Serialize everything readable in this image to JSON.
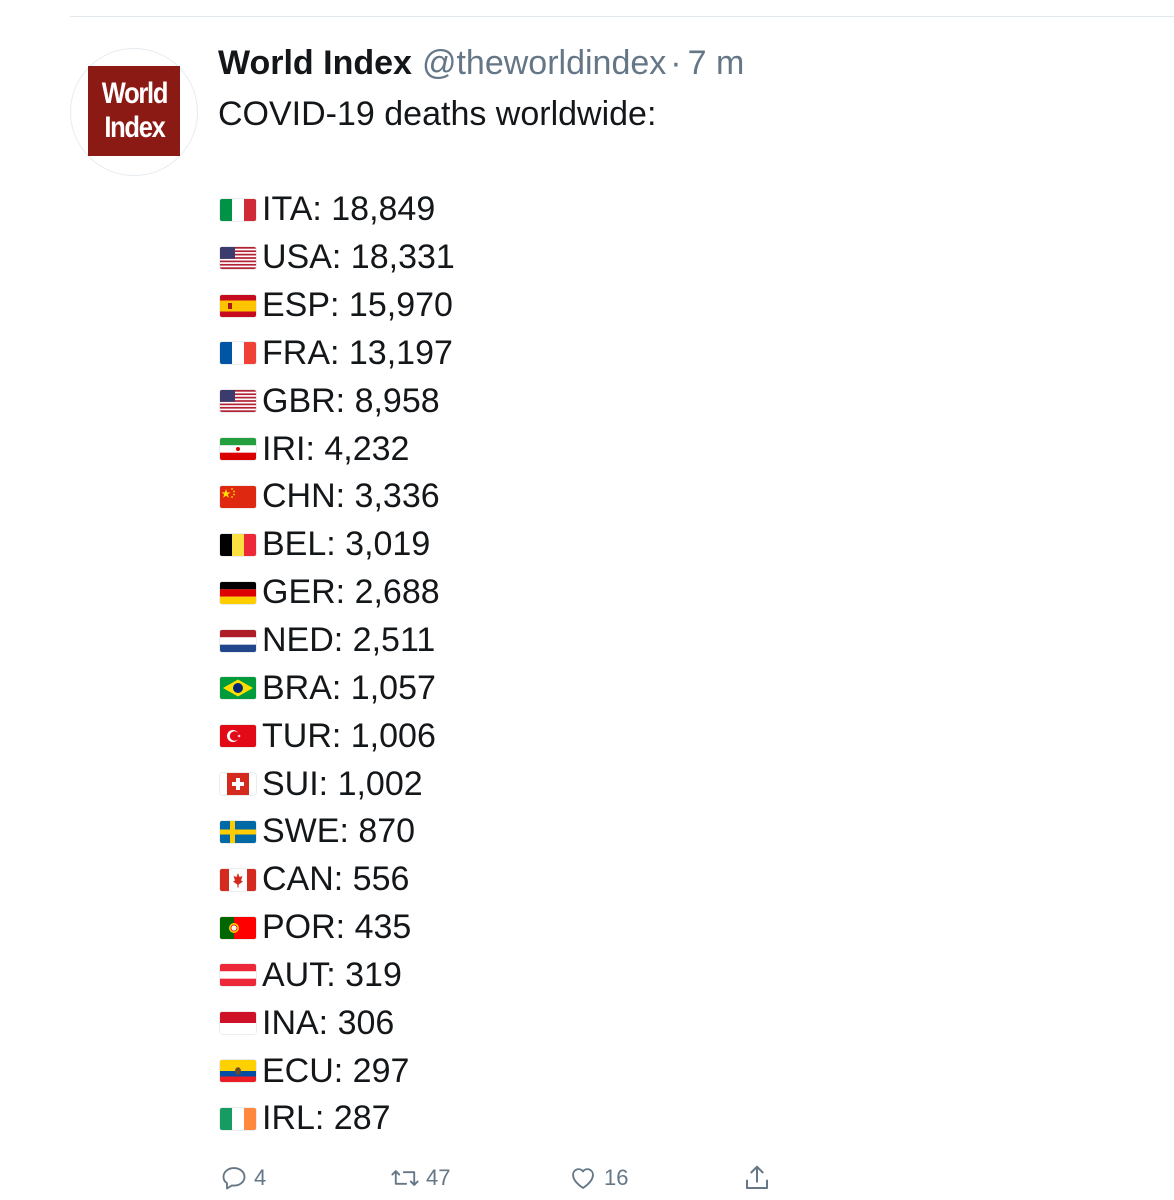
{
  "tweet": {
    "avatar": {
      "logo_line_1": "World",
      "logo_line_2": "Index",
      "logo_color": "#8b1a14"
    },
    "display_name": "World Index",
    "handle": "@theworldindex",
    "separator": "·",
    "time": "7 m",
    "intro": "COVID-19 deaths worldwide:",
    "rows": [
      {
        "flag": "italy-flag-icon",
        "text": "ITA: 18,849"
      },
      {
        "flag": "usa-flag-icon",
        "text": "USA: 18,331"
      },
      {
        "flag": "spain-flag-icon",
        "text": "ESP: 15,970"
      },
      {
        "flag": "france-flag-icon",
        "text": "FRA: 13,197"
      },
      {
        "flag": "usa-flag-icon",
        "text": "GBR: 8,958"
      },
      {
        "flag": "iran-flag-icon",
        "text": "IRI: 4,232"
      },
      {
        "flag": "china-flag-icon",
        "text": "CHN: 3,336"
      },
      {
        "flag": "belgium-flag-icon",
        "text": "BEL: 3,019"
      },
      {
        "flag": "germany-flag-icon",
        "text": "GER: 2,688"
      },
      {
        "flag": "netherlands-flag-icon",
        "text": "NED: 2,511"
      },
      {
        "flag": "brazil-flag-icon",
        "text": "BRA: 1,057"
      },
      {
        "flag": "turkey-flag-icon",
        "text": "TUR: 1,006"
      },
      {
        "flag": "switzerland-flag-icon",
        "text": "SUI: 1,002"
      },
      {
        "flag": "sweden-flag-icon",
        "text": "SWE: 870"
      },
      {
        "flag": "canada-flag-icon",
        "text": "CAN: 556"
      },
      {
        "flag": "portugal-flag-icon",
        "text": "POR: 435"
      },
      {
        "flag": "austria-flag-icon",
        "text": "AUT: 319"
      },
      {
        "flag": "indonesia-flag-icon",
        "text": "INA: 306"
      },
      {
        "flag": "ecuador-flag-icon",
        "text": "ECU: 297"
      },
      {
        "flag": "ireland-flag-icon",
        "text": "IRL: 287"
      }
    ],
    "actions": {
      "reply": {
        "icon": "reply-icon",
        "count": "4"
      },
      "retweet": {
        "icon": "retweet-icon",
        "count": "47"
      },
      "like": {
        "icon": "heart-icon",
        "count": "16"
      },
      "share": {
        "icon": "share-icon"
      }
    },
    "colors": {
      "text": "#14171a",
      "muted": "#657786",
      "divider": "#e1e8ed"
    }
  }
}
